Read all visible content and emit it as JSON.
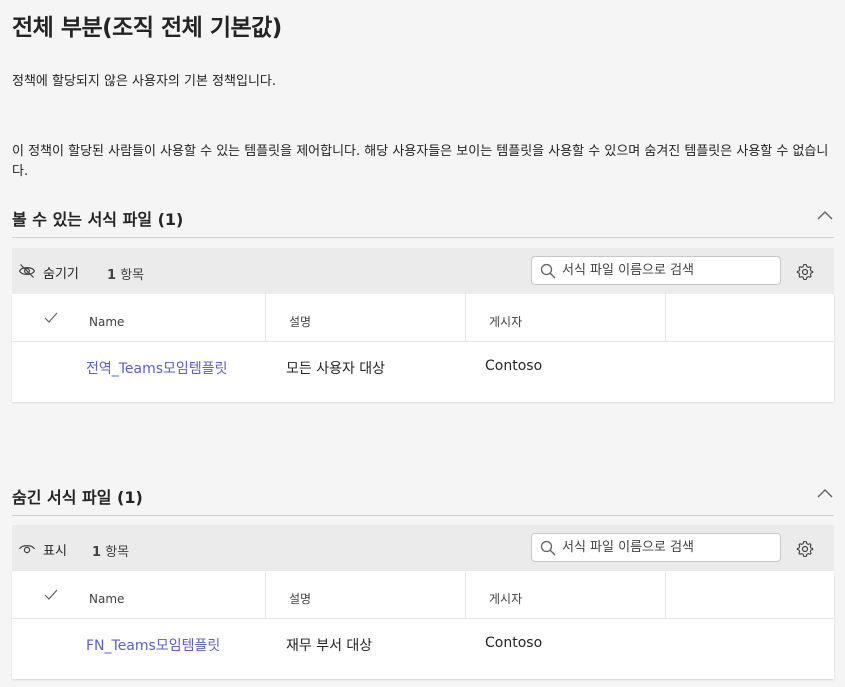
{
  "page": {
    "title": "전체 부분(조직 전체 기본값)",
    "description1": "정책에 할당되지 않은 사용자의 기본 정책입니다.",
    "description2": "이 정책이 할당된 사람들이 사용할 수 있는 템플릿을 제어합니다. 해당 사용자들은 보이는 템플릿을 사용할 수 있으며 숨겨진 템플릿은 사용할 수 없습니다."
  },
  "visible_section": {
    "title": "볼 수 있는 서식 파일 (1)",
    "action_label": "숨기기",
    "count_number": "1",
    "count_unit": "항목",
    "search_placeholder": "서식 파일 이름으로 검색",
    "columns": [
      "Name",
      "설명",
      "게시자"
    ],
    "rows": [
      {
        "name": "전역_Teams모임템플릿",
        "description": "모든 사용자 대상",
        "publisher": "Contoso"
      }
    ]
  },
  "hidden_section": {
    "title": "숨긴 서식 파일 (1)",
    "action_label": "표시",
    "count_number": "1",
    "count_unit": "항목",
    "search_placeholder": "서식 파일 이름으로 검색",
    "columns": [
      "Name",
      "설명",
      "게시자"
    ],
    "rows": [
      {
        "name": "FN_Teams모임템플릿",
        "description": "재무 부서 대상",
        "publisher": "Contoso"
      }
    ]
  },
  "icons": {
    "hide": "eye-off-icon",
    "show": "eye-icon",
    "search": "search-icon",
    "settings": "gear-icon",
    "collapse": "chevron-up-icon",
    "select_all": "checkmark-icon"
  },
  "colors": {
    "link": "#5b5fc7",
    "background": "#f5f5f5",
    "toolbar": "#ebebeb"
  }
}
